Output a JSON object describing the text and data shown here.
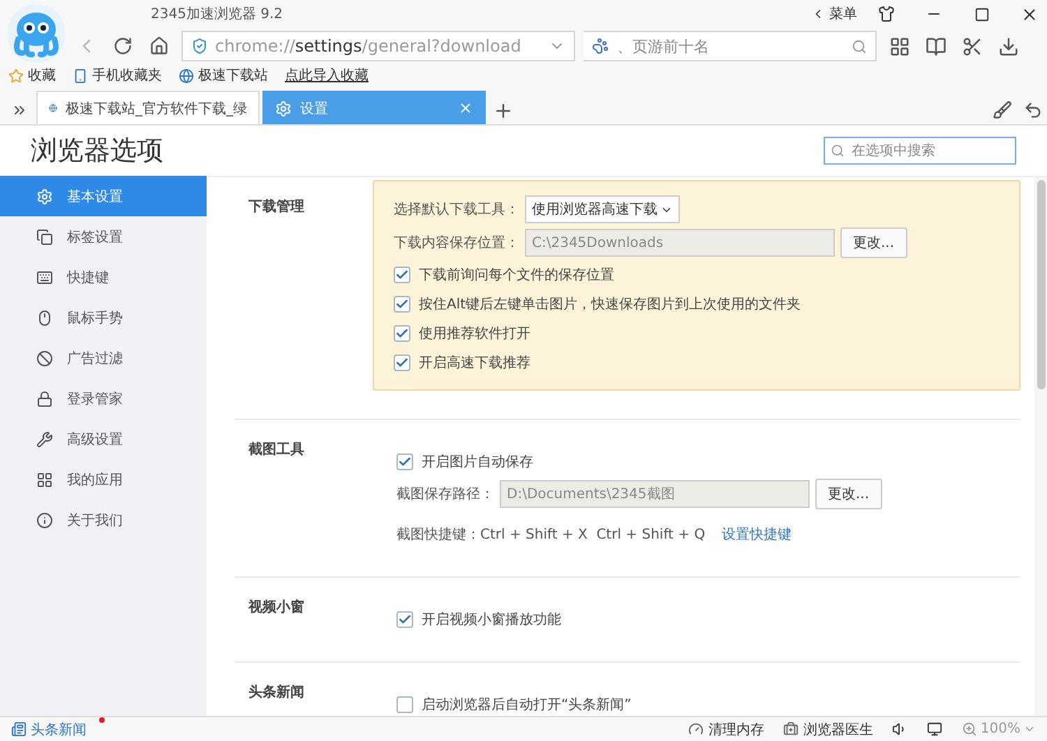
{
  "window": {
    "title": "2345加速浏览器 9.2",
    "menu_label": "菜单"
  },
  "nav": {
    "address": [
      {
        "text": "chrome://",
        "strong": false
      },
      {
        "text": "settings",
        "strong": true
      },
      {
        "text": "/general?download",
        "strong": false
      }
    ],
    "search_placeholder": "、页游前十名"
  },
  "bookmarks": [
    {
      "label": "收藏",
      "kind": "star"
    },
    {
      "label": "手机收藏夹",
      "kind": "phone"
    },
    {
      "label": "极速下载站",
      "kind": "globe"
    },
    {
      "label": "点此导入收藏",
      "kind": "link"
    }
  ],
  "tabs": [
    {
      "label": "极速下载站_官方软件下载_绿",
      "kind": "globe",
      "selected": false
    },
    {
      "label": "设置",
      "kind": "gear",
      "selected": true
    }
  ],
  "page": {
    "title": "浏览器选项",
    "search_placeholder": "在选项中搜索"
  },
  "sidebar": [
    {
      "label": "基本设置",
      "kind": "gear",
      "selected": true
    },
    {
      "label": "标签设置",
      "kind": "tabs",
      "selected": false
    },
    {
      "label": "快捷键",
      "kind": "key",
      "selected": false
    },
    {
      "label": "鼠标手势",
      "kind": "mouse",
      "selected": false
    },
    {
      "label": "广告过滤",
      "kind": "ban",
      "selected": false
    },
    {
      "label": "登录管家",
      "kind": "lock",
      "selected": false
    },
    {
      "label": "高级设置",
      "kind": "wrench",
      "selected": false
    },
    {
      "label": "我的应用",
      "kind": "apps",
      "selected": false
    },
    {
      "label": "关于我们",
      "kind": "info",
      "selected": false
    }
  ],
  "sections": [
    {
      "title": "下载管理",
      "highlighted": true,
      "rows": [
        {
          "kind": "select",
          "label": "选择默认下载工具：",
          "value": "使用浏览器高速下载"
        },
        {
          "kind": "path",
          "label": "下载内容保存位置：",
          "value": "C:\\2345Downloads",
          "button": "更改..."
        },
        {
          "kind": "checkbox",
          "label": "下载前询问每个文件的保存位置",
          "checked": true
        },
        {
          "kind": "checkbox",
          "label": "按住Alt键后左键单击图片，快速保存图片到上次使用的文件夹",
          "checked": true
        },
        {
          "kind": "checkbox",
          "label": "使用推荐软件打开",
          "checked": true
        },
        {
          "kind": "checkbox",
          "label": "开启高速下载推荐",
          "checked": true
        }
      ]
    },
    {
      "title": "截图工具",
      "highlighted": false,
      "rows": [
        {
          "kind": "checkbox",
          "label": "开启图片自动保存",
          "checked": true
        },
        {
          "kind": "path",
          "label": "截图保存路径：",
          "value": "D:\\Documents\\2345截图",
          "button": "更改..."
        },
        {
          "kind": "shortcut",
          "label": "截图快捷键：Ctrl + Shift + X  Ctrl + Shift + Q",
          "link": "设置快捷键"
        }
      ]
    },
    {
      "title": "视频小窗",
      "highlighted": false,
      "rows": [
        {
          "kind": "checkbox",
          "label": "开启视频小窗播放功能",
          "checked": true
        }
      ]
    },
    {
      "title": "头条新闻",
      "highlighted": false,
      "rows": [
        {
          "kind": "checkbox",
          "label": "启动浏览器后自动打开“头条新闻”",
          "checked": false
        }
      ]
    }
  ],
  "status_bar": {
    "news": {
      "label": "头条新闻",
      "unread": true
    },
    "items": [
      {
        "label": "清理内存",
        "kind": "gauge"
      },
      {
        "label": "浏览器医生",
        "kind": "doctor"
      }
    ],
    "zoom": "100%"
  }
}
